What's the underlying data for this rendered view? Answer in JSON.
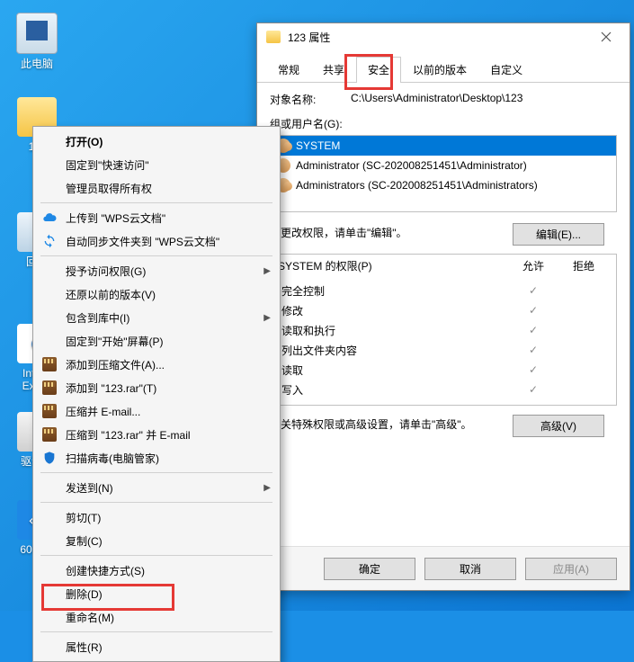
{
  "desktop": {
    "icons": [
      {
        "name": "pc",
        "label": "此电脑"
      },
      {
        "name": "folder",
        "label": "1…"
      },
      {
        "name": "recycle",
        "label": "回…"
      },
      {
        "name": "ie",
        "label": "Inte…\nExp…"
      },
      {
        "name": "drive",
        "label": "驱动…"
      },
      {
        "name": "d360",
        "label": "60驱…"
      }
    ]
  },
  "context_menu": {
    "items": [
      {
        "id": "open",
        "label": "打开(O)",
        "bold": true
      },
      {
        "id": "pin-quick",
        "label": "固定到\"快速访问\""
      },
      {
        "id": "admin-own",
        "label": "管理员取得所有权"
      },
      {
        "sep": true
      },
      {
        "id": "upload-wps",
        "label": "上传到 \"WPS云文档\"",
        "icon": "cloud"
      },
      {
        "id": "sync-wps",
        "label": "自动同步文件夹到 \"WPS云文档\"",
        "icon": "sync"
      },
      {
        "sep": true
      },
      {
        "id": "grant-access",
        "label": "授予访问权限(G)",
        "arrow": true
      },
      {
        "id": "restore-ver",
        "label": "还原以前的版本(V)"
      },
      {
        "id": "include-lib",
        "label": "包含到库中(I)",
        "arrow": true
      },
      {
        "id": "pin-start",
        "label": "固定到\"开始\"屏幕(P)"
      },
      {
        "id": "rar-add",
        "label": "添加到压缩文件(A)...",
        "icon": "rar"
      },
      {
        "id": "rar-add-named",
        "label": "添加到 \"123.rar\"(T)",
        "icon": "rar"
      },
      {
        "id": "rar-email",
        "label": "压缩并 E-mail...",
        "icon": "rar"
      },
      {
        "id": "rar-email-named",
        "label": "压缩到 \"123.rar\" 并 E-mail",
        "icon": "rar"
      },
      {
        "id": "scan",
        "label": "扫描病毒(电脑管家)",
        "icon": "shield"
      },
      {
        "sep": true
      },
      {
        "id": "send-to",
        "label": "发送到(N)",
        "arrow": true
      },
      {
        "sep": true
      },
      {
        "id": "cut",
        "label": "剪切(T)"
      },
      {
        "id": "copy",
        "label": "复制(C)"
      },
      {
        "sep": true
      },
      {
        "id": "shortcut",
        "label": "创建快捷方式(S)"
      },
      {
        "id": "delete",
        "label": "删除(D)"
      },
      {
        "id": "rename",
        "label": "重命名(M)"
      },
      {
        "sep": true
      },
      {
        "id": "properties",
        "label": "属性(R)"
      }
    ]
  },
  "properties": {
    "title": "123 属性",
    "tabs": [
      "常规",
      "共享",
      "安全",
      "以前的版本",
      "自定义"
    ],
    "active_tab": 2,
    "object_label": "对象名称:",
    "object_path": "C:\\Users\\Administrator\\Desktop\\123",
    "group_label": "组或用户名(G):",
    "groups": [
      {
        "label": "SYSTEM",
        "type": "group",
        "selected": true
      },
      {
        "label": "Administrator (SC-202008251451\\Administrator)",
        "type": "user"
      },
      {
        "label": "Administrators (SC-202008251451\\Administrators)",
        "type": "group"
      }
    ],
    "edit_hint": "要更改权限，请单击\"编辑\"。",
    "edit_btn": "编辑(E)...",
    "perm_header_label": "SYSTEM 的权限(P)",
    "perm_allow": "允许",
    "perm_deny": "拒绝",
    "permissions": [
      {
        "name": "完全控制",
        "allow": true,
        "deny": false
      },
      {
        "name": "修改",
        "allow": true,
        "deny": false
      },
      {
        "name": "读取和执行",
        "allow": true,
        "deny": false
      },
      {
        "name": "列出文件夹内容",
        "allow": true,
        "deny": false
      },
      {
        "name": "读取",
        "allow": true,
        "deny": false
      },
      {
        "name": "写入",
        "allow": true,
        "deny": false
      }
    ],
    "adv_hint": "有关特殊权限或高级设置，请单击\"高级\"。",
    "adv_btn": "高级(V)",
    "ok_btn": "确定",
    "cancel_btn": "取消",
    "apply_btn": "应用(A)"
  }
}
